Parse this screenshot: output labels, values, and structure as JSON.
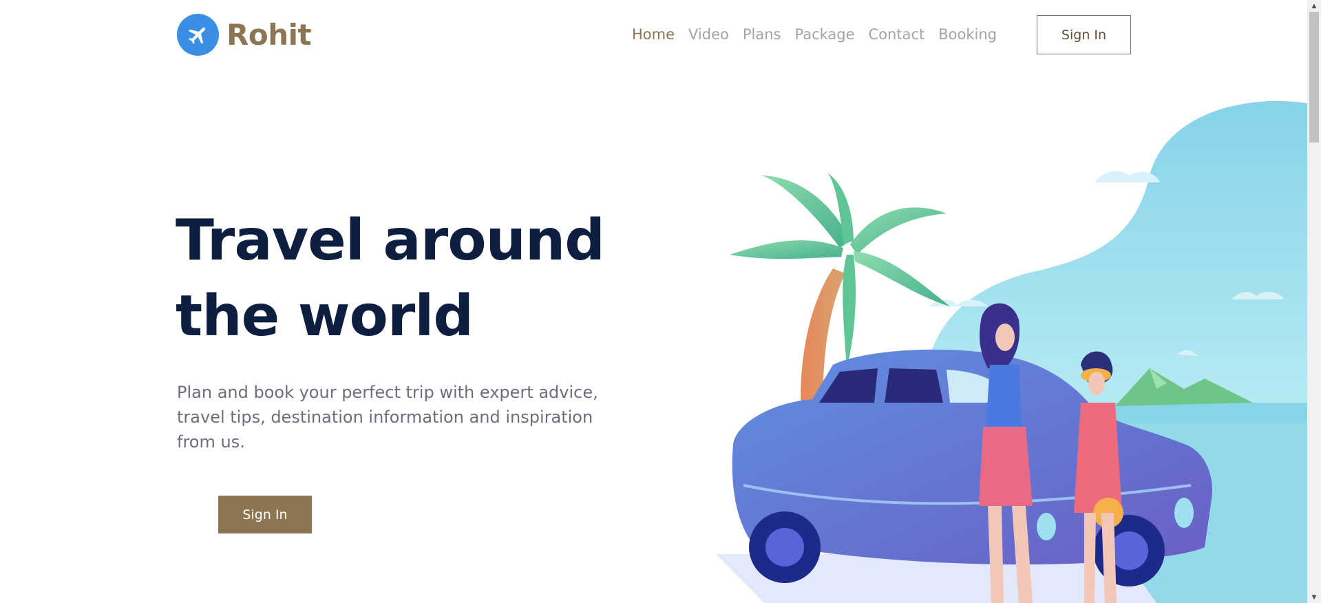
{
  "brand": {
    "name": "Rohit",
    "logo_icon": "airplane-icon",
    "logo_color": "#3a8ee6",
    "brand_color": "#8c7553"
  },
  "nav": {
    "items": [
      {
        "label": "Home",
        "active": true
      },
      {
        "label": "Video",
        "active": false
      },
      {
        "label": "Plans",
        "active": false
      },
      {
        "label": "Package",
        "active": false
      },
      {
        "label": "Contact",
        "active": false
      },
      {
        "label": "Booking",
        "active": false
      }
    ]
  },
  "header": {
    "signin_label": "Sign In"
  },
  "hero": {
    "title_line1": "Travel around",
    "title_line2": "the world",
    "subtitle": "Plan and book your perfect trip with expert advice, travel tips, destination information and inspiration from us.",
    "cta_label": "Sign In",
    "title_color": "#0e1e41"
  },
  "illustration": {
    "icon": "travel-beach-car-illustration"
  },
  "scrollbar": {
    "up_icon": "scroll-up-arrow-icon",
    "down_icon": "scroll-down-arrow-icon"
  }
}
